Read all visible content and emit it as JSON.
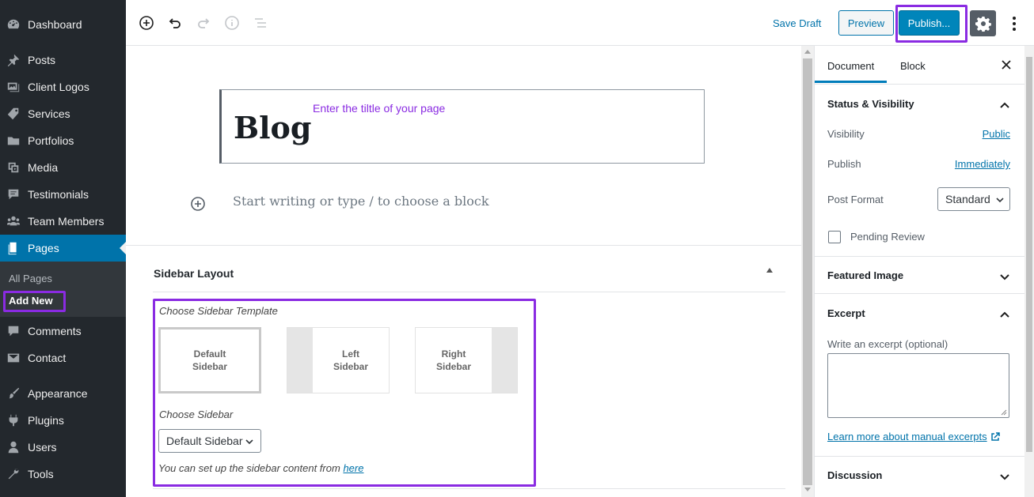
{
  "admin_menu": {
    "items": [
      {
        "id": "dashboard",
        "label": "Dashboard",
        "icon": "dashboard-icon"
      },
      {
        "id": "posts",
        "label": "Posts",
        "icon": "pin-icon"
      },
      {
        "id": "client-logos",
        "label": "Client Logos",
        "icon": "images-icon"
      },
      {
        "id": "services",
        "label": "Services",
        "icon": "tag-icon"
      },
      {
        "id": "portfolios",
        "label": "Portfolios",
        "icon": "folder-icon"
      },
      {
        "id": "media",
        "label": "Media",
        "icon": "media-icon"
      },
      {
        "id": "testimonials",
        "label": "Testimonials",
        "icon": "testimonial-icon"
      },
      {
        "id": "team-members",
        "label": "Team Members",
        "icon": "groups-icon"
      },
      {
        "id": "pages",
        "label": "Pages",
        "icon": "page-icon"
      },
      {
        "id": "comments",
        "label": "Comments",
        "icon": "comment-icon"
      },
      {
        "id": "contact",
        "label": "Contact",
        "icon": "email-icon"
      },
      {
        "id": "appearance",
        "label": "Appearance",
        "icon": "brush-icon"
      },
      {
        "id": "plugins",
        "label": "Plugins",
        "icon": "plug-icon"
      },
      {
        "id": "users",
        "label": "Users",
        "icon": "user-icon"
      },
      {
        "id": "tools",
        "label": "Tools",
        "icon": "wrench-icon"
      }
    ],
    "submenu": {
      "all_pages": "All Pages",
      "add_new": "Add New"
    }
  },
  "toolbar": {
    "save_draft": "Save Draft",
    "preview": "Preview",
    "publish": "Publish..."
  },
  "editor": {
    "title": "Blog",
    "title_hint": "Enter the tiltle of your page",
    "appender_placeholder": "Start writing or type / to choose a block"
  },
  "sidebar_layout": {
    "title": "Sidebar Layout",
    "choose_template_label": "Choose Sidebar Template",
    "templates": [
      {
        "line1": "Default",
        "line2": "Sidebar"
      },
      {
        "line1": "Left",
        "line2": "Sidebar"
      },
      {
        "line1": "Right",
        "line2": "Sidebar"
      }
    ],
    "selected_template": "Default Sidebar",
    "choose_sidebar_label": "Choose Sidebar",
    "sidebar_select_value": "Default Sidebar",
    "setup_note": "You can set up the sidebar content from",
    "setup_link": "here"
  },
  "settings": {
    "tabs": {
      "document": "Document",
      "block": "Block"
    },
    "status_visibility": {
      "title": "Status & Visibility",
      "visibility_label": "Visibility",
      "visibility_value": "Public",
      "publish_label": "Publish",
      "publish_value": "Immediately",
      "post_format_label": "Post Format",
      "post_format_value": "Standard",
      "pending_review": "Pending Review"
    },
    "featured_image": {
      "title": "Featured Image"
    },
    "excerpt": {
      "title": "Excerpt",
      "label": "Write an excerpt (optional)",
      "learn_more": "Learn more about manual excerpts"
    },
    "discussion": {
      "title": "Discussion"
    }
  },
  "colors": {
    "admin_bg": "#23282d",
    "admin_active": "#0073aa",
    "accent": "#0085ba",
    "highlight": "#8a2be2"
  }
}
